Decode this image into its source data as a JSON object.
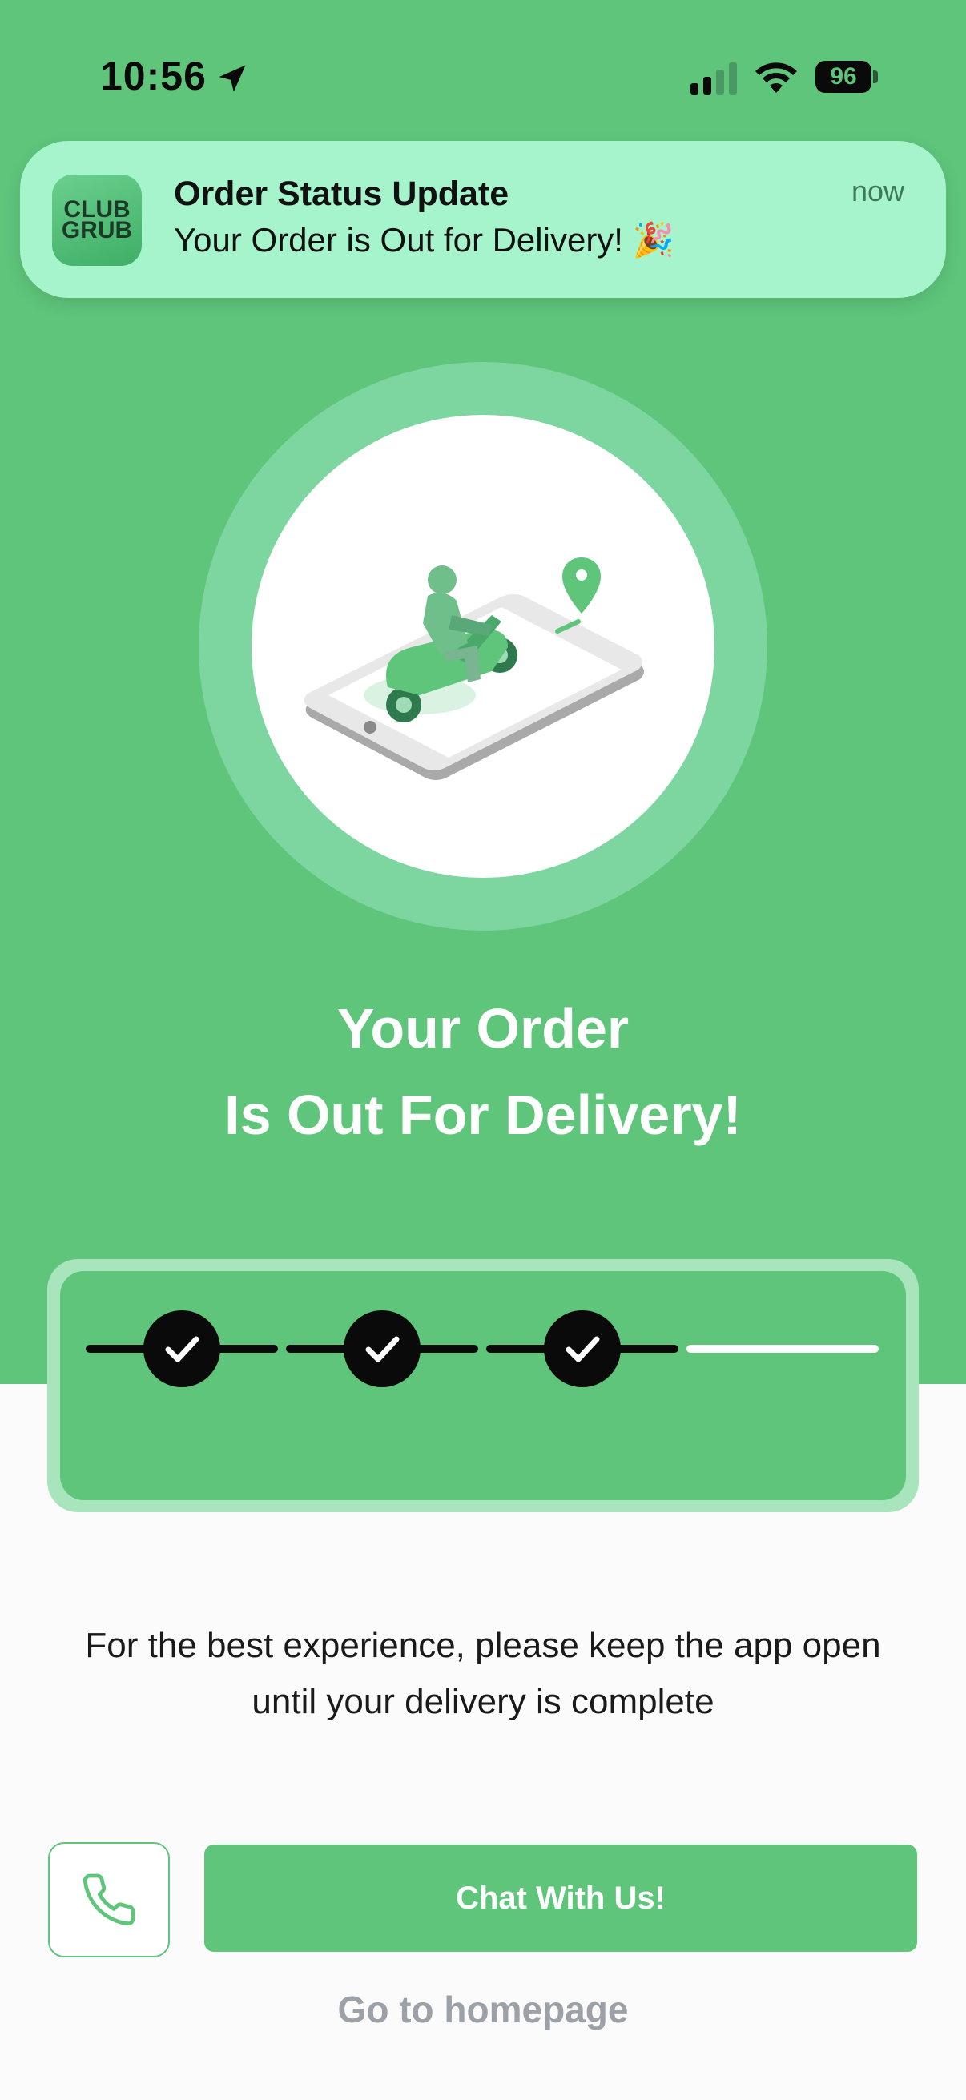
{
  "status_bar": {
    "time": "10:56",
    "battery": "96",
    "location_icon": "location-arrow-icon",
    "signal_icon": "cellular-signal-icon",
    "wifi_icon": "wifi-icon"
  },
  "notification": {
    "app_icon_line1": "CLUB",
    "app_icon_line2": "GRUB",
    "title": "Order Status Update",
    "body": "Your Order is Out for Delivery! 🎉",
    "time": "now"
  },
  "illustration": {
    "icon": "scooter-delivery-on-phone-icon"
  },
  "headline": {
    "line1": "Your Order",
    "line2": "Is Out For Delivery!"
  },
  "progress": {
    "steps_total": 4,
    "steps_completed": 3
  },
  "info_text": {
    "line1": "For the best experience, please keep the app open",
    "line2": "until your delivery is complete"
  },
  "actions": {
    "call_icon": "phone-icon",
    "chat_label": "Chat With Us!",
    "home_label": "Go to homepage"
  },
  "colors": {
    "primary": "#5ec57b",
    "notification_bg": "#a6f4cb",
    "ring": "#7dd6a0",
    "link_gray": "#9ba1a6"
  }
}
